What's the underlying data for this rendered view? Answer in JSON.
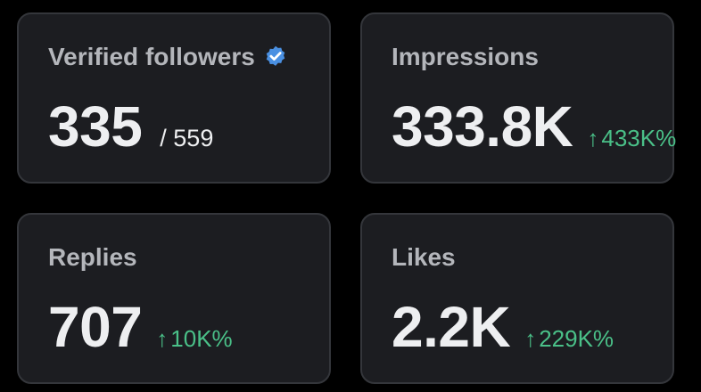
{
  "cards": {
    "verified": {
      "title": "Verified followers",
      "value": "335",
      "total": "/ 559",
      "badge_icon": "verified-badge-icon",
      "badge_color": "#4a90e2"
    },
    "impressions": {
      "title": "Impressions",
      "value": "333.8K",
      "change": "433K%",
      "change_icon": "arrow-up-icon"
    },
    "replies": {
      "title": "Replies",
      "value": "707",
      "change": "10K%",
      "change_icon": "arrow-up-icon"
    },
    "likes": {
      "title": "Likes",
      "value": "2.2K",
      "change": "229K%",
      "change_icon": "arrow-up-icon"
    }
  },
  "colors": {
    "background": "#000000",
    "card": "#1c1d21",
    "card_border": "#34363b",
    "title": "#b4b6bb",
    "value": "#eeeff1",
    "positive_change": "#4ac088"
  }
}
